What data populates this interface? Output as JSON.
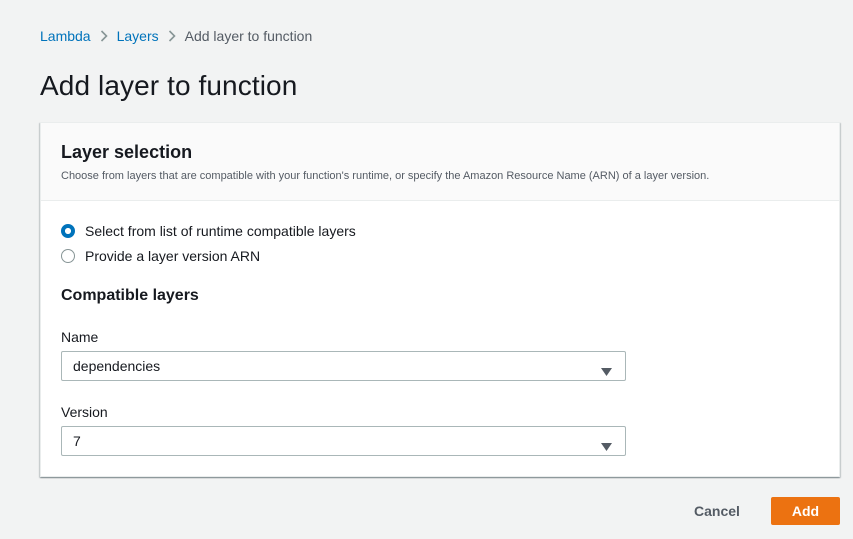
{
  "breadcrumb": {
    "items": [
      {
        "label": "Lambda"
      },
      {
        "label": "Layers"
      },
      {
        "label": "Add layer to function"
      }
    ]
  },
  "page": {
    "title": "Add layer to function"
  },
  "layer_selection": {
    "title": "Layer selection",
    "description": "Choose from layers that are compatible with your function's runtime, or specify the Amazon Resource Name (ARN) of a layer version.",
    "options": [
      {
        "label": "Select from list of runtime compatible layers",
        "selected": true
      },
      {
        "label": "Provide a layer version ARN",
        "selected": false
      }
    ]
  },
  "compatible_layers": {
    "title": "Compatible layers",
    "name": {
      "label": "Name",
      "value": "dependencies"
    },
    "version": {
      "label": "Version",
      "value": "7"
    }
  },
  "footer": {
    "cancel_label": "Cancel",
    "add_label": "Add"
  },
  "colors": {
    "accent": "#0073bb",
    "primary_button": "#ec7211"
  }
}
